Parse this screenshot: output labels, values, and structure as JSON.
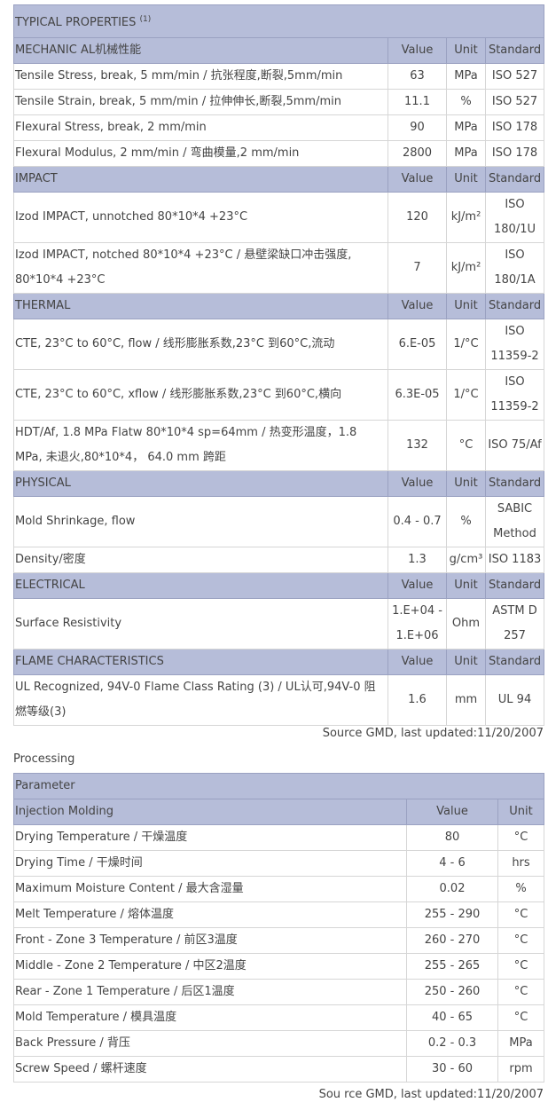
{
  "properties": {
    "title": "TYPICAL PROPERTIES",
    "title_sup": "(1)",
    "col_value": "Value",
    "col_unit": "Unit",
    "col_standard": "Standard",
    "sections": [
      {
        "name": "MECHANIC AL机械性能",
        "rows": [
          {
            "prop": "Tensile Stress, break, 5 mm/min / 抗张程度,断裂,5mm/min",
            "value": "63",
            "unit": "MPa",
            "standard": "ISO 527"
          },
          {
            "prop": "Tensile Strain, break, 5 mm/min / 拉伸伸长,断裂,5mm/min",
            "value": "11.1",
            "unit": "%",
            "standard": "ISO 527"
          },
          {
            "prop": "Flexural Stress, break, 2 mm/min",
            "value": "90",
            "unit": "MPa",
            "standard": "ISO 178"
          },
          {
            "prop": "Flexural Modulus, 2 mm/min / 弯曲模量,2 mm/min",
            "value": "2800",
            "unit": "MPa",
            "standard": "ISO 178"
          }
        ]
      },
      {
        "name": "IMPACT",
        "rows": [
          {
            "prop": "Izod IMPACT, unnotched 80*10*4 +23°C",
            "value": "120",
            "unit": "kJ/m²",
            "standard": "ISO 180/1U",
            "tall": true
          },
          {
            "prop": "Izod IMPACT, notched 80*10*4 +23°C / 悬壁梁缺口冲击强度, 80*10*4 +23°C",
            "value": "7",
            "unit": "kJ/m²",
            "standard": "ISO 180/1A",
            "tall": true
          }
        ]
      },
      {
        "name": "THERMAL",
        "rows": [
          {
            "prop": "CTE, 23°C to 60°C, flow / 线形膨胀系数,23°C 到60°C,流动",
            "value": "6.E-05",
            "unit": "1/°C",
            "standard": "ISO 11359-2",
            "tall": true
          },
          {
            "prop": "CTE, 23°C to 60°C, xflow / 线形膨胀系数,23°C 到60°C,横向",
            "value": "6.3E-05",
            "unit": "1/°C",
            "standard": "ISO 11359-2",
            "tall": true
          },
          {
            "prop": "HDT/Af, 1.8 MPa Flatw 80*10*4 sp=64mm / 热变形温度，1.8 MPa, 未退火,80*10*4， 64.0 mm 跨距",
            "value": "132",
            "unit": "°C",
            "standard": "ISO 75/Af",
            "tall": true
          }
        ]
      },
      {
        "name": "PHYSICAL",
        "rows": [
          {
            "prop": "Mold Shrinkage, flow",
            "value": "0.4 - 0.7",
            "unit": "%",
            "standard": "SABIC Method",
            "tall": true
          },
          {
            "prop": "Density/密度",
            "value": "1.3",
            "unit": "g/cm³",
            "standard": "ISO 1183"
          }
        ]
      },
      {
        "name": "ELECTRICAL",
        "rows": [
          {
            "prop": "Surface Resistivity",
            "value": "1.E+04 - 1.E+06",
            "unit": "Ohm",
            "standard": "ASTM D 257",
            "tall": true
          }
        ]
      },
      {
        "name": "FLAME CHARACTERISTICS",
        "rows": [
          {
            "prop": "UL Recognized, 94V-0 Flame Class Rating (3) / UL认可,94V-0 阻燃等级(3)",
            "value": "1.6",
            "unit": "mm",
            "standard": "UL 94",
            "tall": true
          }
        ]
      }
    ],
    "source": "Source GMD, last updated:11/20/2007"
  },
  "processing": {
    "title": "Processing",
    "header": "Parameter",
    "section": "Injection Molding",
    "col_value": "Value",
    "col_unit": "Unit",
    "rows": [
      {
        "param": "Drying Temperature / 干燥温度",
        "value": "80",
        "unit": "°C"
      },
      {
        "param": "Drying Time / 干燥时间",
        "value": "4 - 6",
        "unit": "hrs"
      },
      {
        "param": "Maximum Moisture Content / 最大含湿量",
        "value": "0.02",
        "unit": "%"
      },
      {
        "param": "Melt Temperature / 熔体温度",
        "value": "255 - 290",
        "unit": "°C"
      },
      {
        "param": "Front - Zone 3 Temperature / 前区3温度",
        "value": "260 - 270",
        "unit": "°C"
      },
      {
        "param": "Middle - Zone 2 Temperature / 中区2温度",
        "value": "255 - 265",
        "unit": "°C"
      },
      {
        "param": "Rear - Zone 1 Temperature / 后区1温度",
        "value": "250 - 260",
        "unit": "°C"
      },
      {
        "param": "Mold Temperature / 模具温度",
        "value": "40 - 65",
        "unit": "°C"
      },
      {
        "param": "Back Pressure / 背压",
        "value": "0.2 - 0.3",
        "unit": "MPa"
      },
      {
        "param": "Screw Speed / 螺杆速度",
        "value": "30 - 60",
        "unit": "rpm"
      }
    ],
    "source": "Sou rce GMD, last updated:11/20/2007"
  }
}
